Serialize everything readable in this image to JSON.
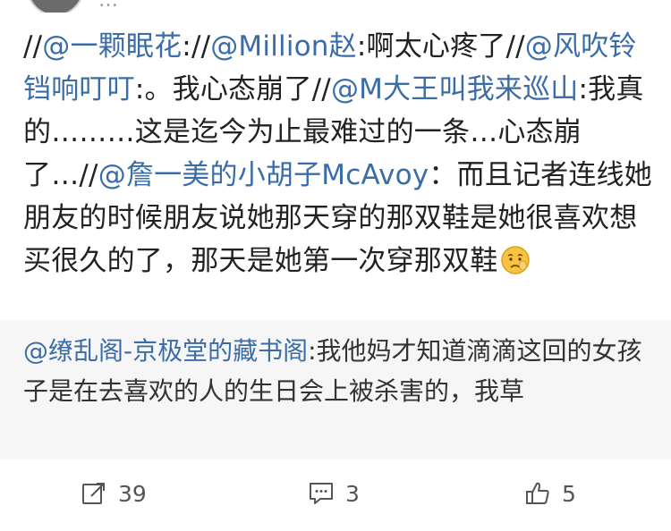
{
  "header": {
    "meta_text": "…"
  },
  "post": {
    "segments": [
      {
        "kind": "text",
        "text": "//"
      },
      {
        "kind": "mention",
        "text": "@一颗眠花"
      },
      {
        "kind": "text",
        "text": "://"
      },
      {
        "kind": "mention",
        "text": "@Million赵"
      },
      {
        "kind": "text",
        "text": ":啊太心疼了//"
      },
      {
        "kind": "mention",
        "text": "@风吹铃铛响叮叮"
      },
      {
        "kind": "text",
        "text": ":。我心态崩了//"
      },
      {
        "kind": "mention",
        "text": "@M大王叫我来巡山"
      },
      {
        "kind": "text",
        "text": ":我真的………这是迄今为止最难过的一条…心态崩了…//"
      },
      {
        "kind": "mention",
        "text": "@詹一美的小胡子McAvoy"
      },
      {
        "kind": "text",
        "text": "：而且记者连线她朋友的时候朋友说她那天穿的那双鞋是她很喜欢想买很久的了，那天是她第一次穿那双鞋"
      }
    ],
    "emoji": "sad-face-emoji"
  },
  "quote": {
    "author": "@缭乱阁-京极堂的藏书阁",
    "text": ":我他妈才知道滴滴这回的女孩子是在去喜欢的人的生日会上被杀害的，我草"
  },
  "actions": {
    "repost_count": "39",
    "comment_count": "3",
    "like_count": "5"
  },
  "colors": {
    "mention": "#3a6da8",
    "quote_background": "#f6f6f6",
    "text": "#222222",
    "icon": "#555555"
  }
}
